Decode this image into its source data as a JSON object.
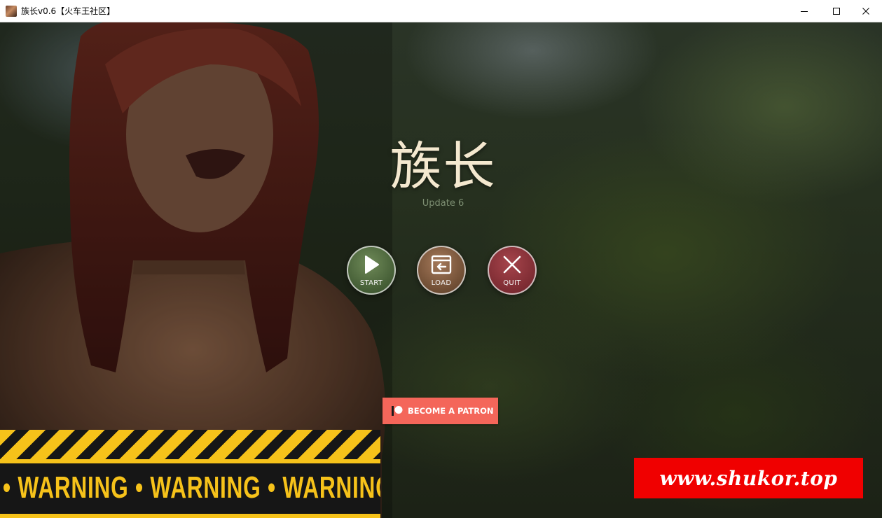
{
  "window": {
    "title": "族长v0.6【火车王社区】",
    "icons": [
      "app-icon",
      "minimize-icon",
      "maximize-icon",
      "close-icon"
    ]
  },
  "game": {
    "title": "族长",
    "subtitle": "Update 6",
    "colors": {
      "title": "#f4e8cf",
      "subtitle": "#7d8f72"
    }
  },
  "menu": {
    "start": {
      "label": "START",
      "icon": "play-icon",
      "color": "#415a33"
    },
    "load": {
      "label": "LOAD",
      "icon": "load-icon",
      "color": "#6b4a31"
    },
    "quit": {
      "label": "QUIT",
      "icon": "x-icon",
      "color": "#7a2a31"
    }
  },
  "patreon": {
    "label": "BECOME A PATRON",
    "icon": "patreon-icon",
    "color": "#f4665a"
  },
  "warning_banner": {
    "text": "• WARNING • WARNING • WARNING • WARNI",
    "color": "#f6c21a"
  },
  "watermark": {
    "text": "www.shukor.top",
    "color": "#f00000"
  }
}
